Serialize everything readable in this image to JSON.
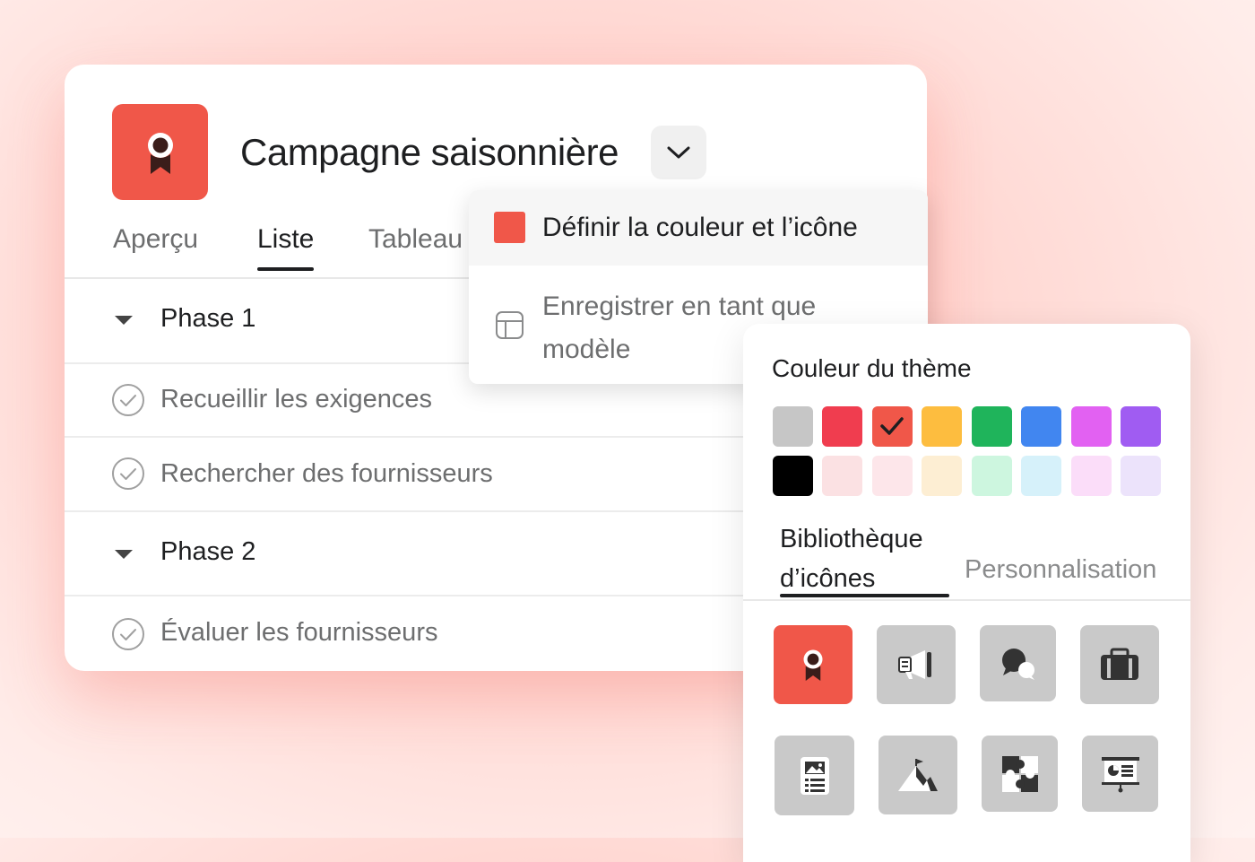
{
  "project": {
    "title": "Campagne saisonnière",
    "icon": "ribbon-award-icon",
    "color": "#f05749"
  },
  "tabs": [
    {
      "label": "Aperçu",
      "active": false
    },
    {
      "label": "Liste",
      "active": true
    },
    {
      "label": "Tableau",
      "active": false
    }
  ],
  "rows": [
    {
      "type": "section",
      "label": "Phase 1"
    },
    {
      "type": "task",
      "label": "Recueillir les exigences"
    },
    {
      "type": "task",
      "label": "Rechercher des fournisseurs"
    },
    {
      "type": "section",
      "label": "Phase 2"
    },
    {
      "type": "task",
      "label": "Évaluer les fournisseurs"
    }
  ],
  "menu": {
    "items": [
      {
        "label": "Définir la couleur et l’icône",
        "icon": "color-swatch-icon"
      },
      {
        "label": "Enregistrer en tant que modèle",
        "icon": "template-icon"
      }
    ]
  },
  "panel": {
    "title": "Couleur du thème",
    "swatches": [
      {
        "color": "#c6c6c6",
        "selected": false
      },
      {
        "color": "#f03d4f",
        "selected": false
      },
      {
        "color": "#f05749",
        "selected": true
      },
      {
        "color": "#fdbd3f",
        "selected": false
      },
      {
        "color": "#1fb45b",
        "selected": false
      },
      {
        "color": "#4186f0",
        "selected": false
      },
      {
        "color": "#e261f2",
        "selected": false
      },
      {
        "color": "#a05cf2",
        "selected": false
      },
      {
        "color": "#000000",
        "selected": false
      },
      {
        "color": "#fbe1e3",
        "selected": false
      },
      {
        "color": "#fde6ea",
        "selected": false
      },
      {
        "color": "#fdeed3",
        "selected": false
      },
      {
        "color": "#cdf6df",
        "selected": false
      },
      {
        "color": "#d6f1fa",
        "selected": false
      },
      {
        "color": "#fbddf9",
        "selected": false
      },
      {
        "color": "#ece3fb",
        "selected": false
      }
    ],
    "library_tab": "Bibliothèque d’icônes",
    "custom_tab": "Personnalisation",
    "icons": [
      {
        "name": "ribbon-award-icon",
        "selected": true
      },
      {
        "name": "megaphone-icon",
        "selected": false
      },
      {
        "name": "chat-bubbles-icon",
        "selected": false
      },
      {
        "name": "briefcase-icon",
        "selected": false
      },
      {
        "name": "document-list-icon",
        "selected": false
      },
      {
        "name": "mountain-flag-icon",
        "selected": false
      },
      {
        "name": "puzzle-icon",
        "selected": false
      },
      {
        "name": "presentation-icon",
        "selected": false
      }
    ]
  }
}
